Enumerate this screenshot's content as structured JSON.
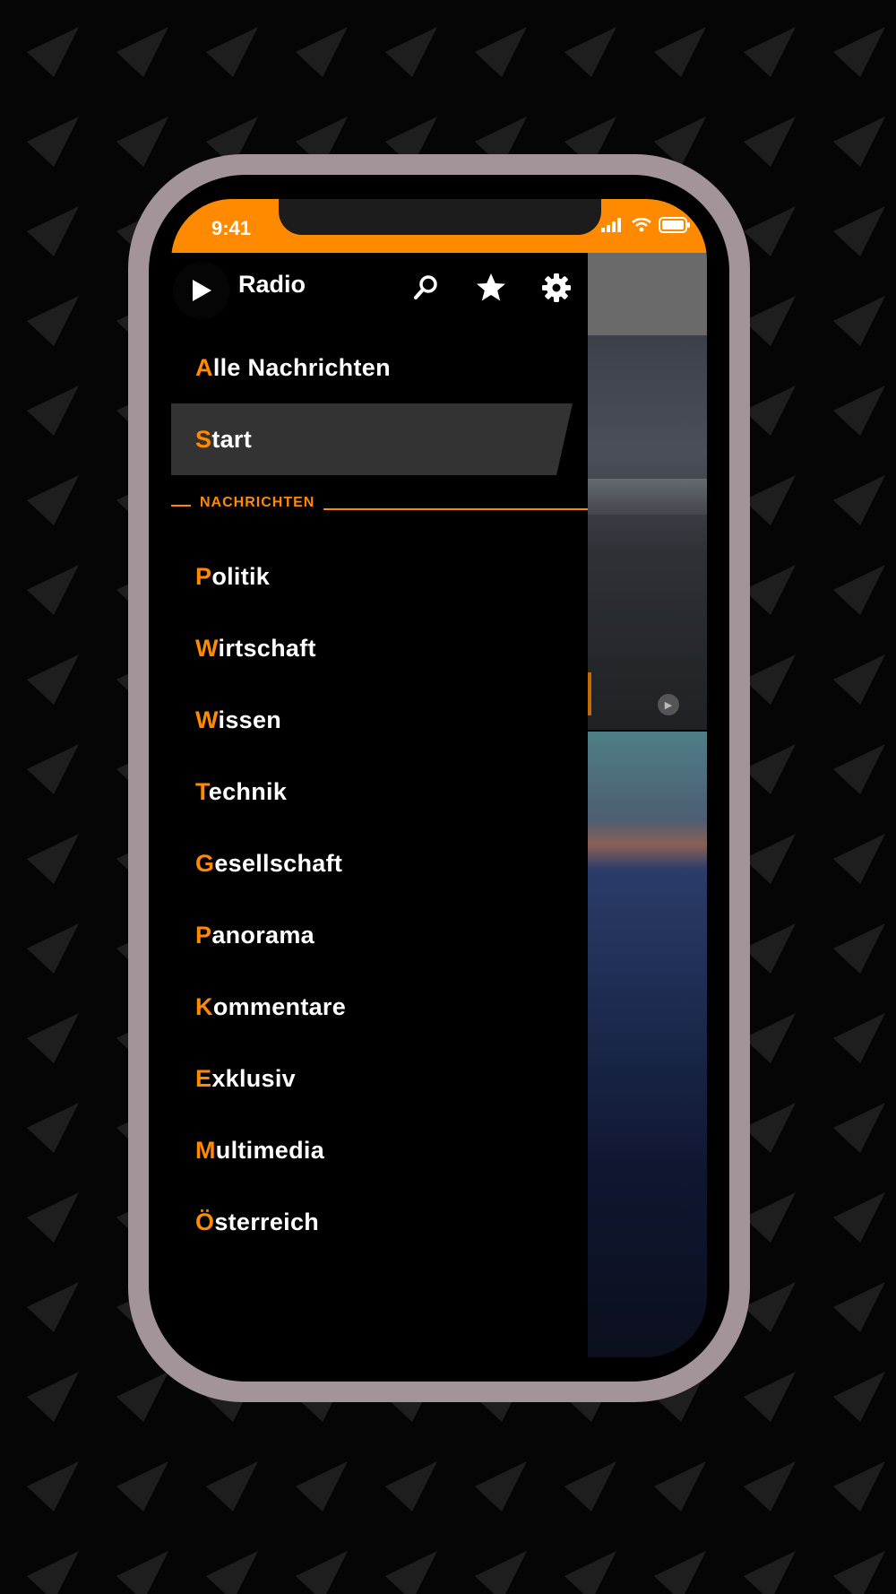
{
  "status_bar": {
    "time": "9:41"
  },
  "drawer": {
    "title": "Radio",
    "top_items": [
      {
        "first": "A",
        "rest": "lle Nachrichten"
      },
      {
        "first": "S",
        "rest": "tart",
        "active": true
      }
    ],
    "section_label": "NACHRICHTEN",
    "items": [
      {
        "first": "P",
        "rest": "olitik"
      },
      {
        "first": "W",
        "rest": "irtschaft"
      },
      {
        "first": "W",
        "rest": "issen"
      },
      {
        "first": "T",
        "rest": "echnik"
      },
      {
        "first": "G",
        "rest": "esellschaft"
      },
      {
        "first": "P",
        "rest": "anorama"
      },
      {
        "first": "K",
        "rest": "ommentare"
      },
      {
        "first": "E",
        "rest": "xklusiv"
      },
      {
        "first": "M",
        "rest": "ultimedia"
      },
      {
        "first": "Ö",
        "rest": "sterreich"
      }
    ]
  },
  "icons": {
    "play": "play-icon",
    "search": "search-icon",
    "favorites": "star-icon",
    "settings": "gear-icon",
    "signal": "signal-icon",
    "wifi": "wifi-icon",
    "battery": "battery-icon"
  },
  "colors": {
    "accent": "#ff8a00",
    "active_bg": "#333333",
    "frame": "#a39499"
  }
}
